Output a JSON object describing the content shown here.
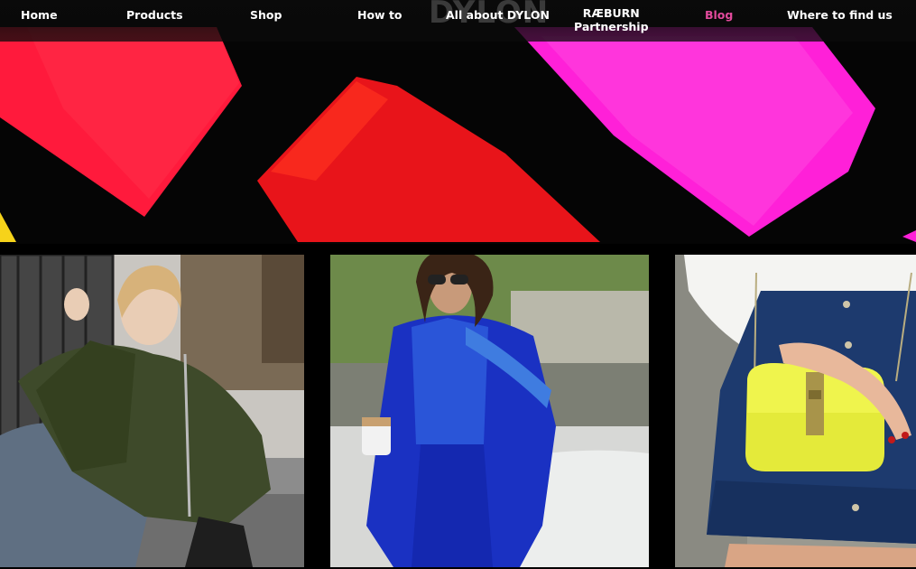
{
  "nav": {
    "logo": "DYLON",
    "items": [
      {
        "label": "Home"
      },
      {
        "label": "Products"
      },
      {
        "label": "Shop"
      },
      {
        "label": "How to"
      },
      {
        "label": "All about DYLON"
      },
      {
        "label": "RÆBURN Partnership",
        "line1": "RÆBURN",
        "line2": "Partnership"
      },
      {
        "label": "Blog"
      },
      {
        "label": "Where to find us"
      }
    ],
    "active_color": "#e24a9c"
  },
  "hero": {
    "colors": [
      "#ff1a3c",
      "#e8141a",
      "#ff20d8",
      "#f6d31a"
    ]
  },
  "gallery": {
    "photos": [
      {
        "description": "woman-green-shirt-photo"
      },
      {
        "description": "woman-blue-suit-photo"
      },
      {
        "description": "yellow-bag-denim-skirt-photo"
      }
    ]
  }
}
